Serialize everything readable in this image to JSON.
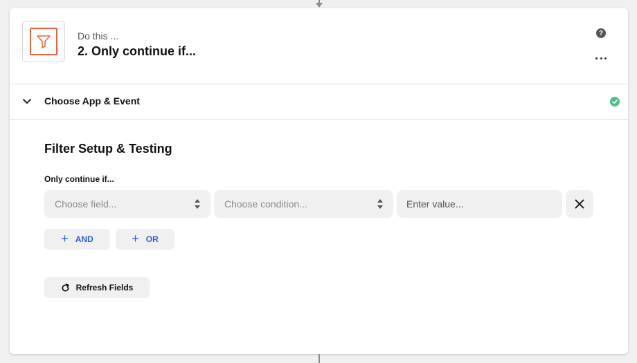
{
  "step": {
    "pre_title": "Do this ...",
    "title": "2. Only continue if...",
    "icon": "filter-icon",
    "accent_color": "#e8643d"
  },
  "section": {
    "label": "Choose App & Event",
    "status_color": "#4cc08a"
  },
  "filter": {
    "heading": "Filter Setup & Testing",
    "label": "Only continue if...",
    "field_placeholder": "Choose field...",
    "condition_placeholder": "Choose condition...",
    "value_placeholder": "Enter value...",
    "and_label": "AND",
    "or_label": "OR",
    "refresh_label": "Refresh Fields",
    "link_color": "#2d5fd6"
  }
}
